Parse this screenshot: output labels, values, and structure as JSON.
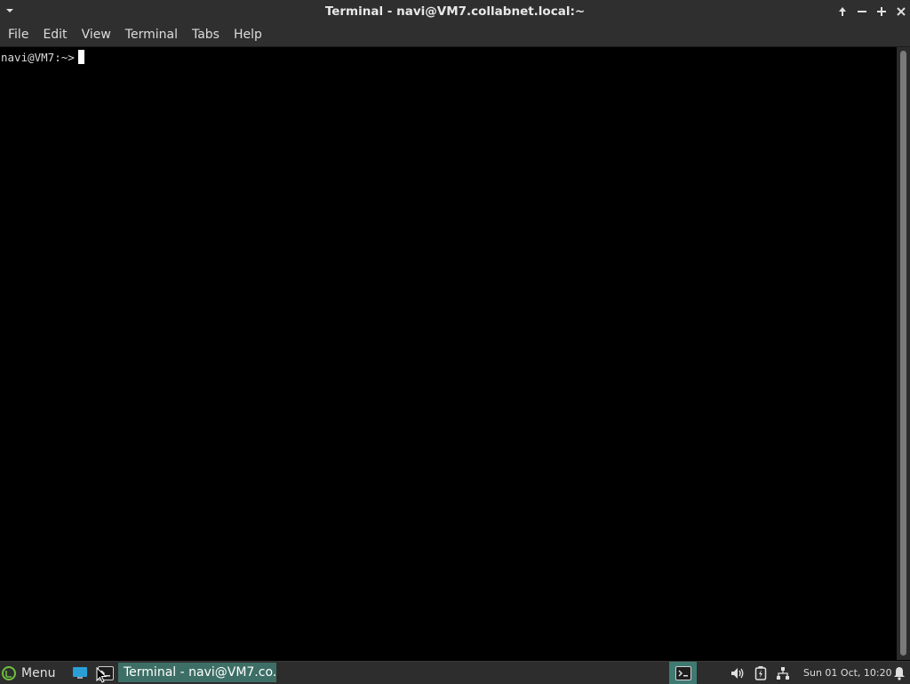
{
  "window": {
    "title": "Terminal - navi@VM7.collabnet.local:~",
    "controls": [
      "maximize-up",
      "minimize",
      "maximize",
      "close"
    ]
  },
  "menubar": {
    "items": [
      "File",
      "Edit",
      "View",
      "Terminal",
      "Tabs",
      "Help"
    ]
  },
  "terminal": {
    "prompt": "navi@VM7:~>"
  },
  "panel": {
    "menu_label": "Menu",
    "task_label": "Terminal - navi@VM7.co...",
    "clock": "Sun 01 Oct, 10:20"
  },
  "colors": {
    "accent": "#3d6f66",
    "titlebar_bg": "#2f2f2f",
    "terminal_bg": "#000000",
    "menu_logo": "#6fbf3f"
  },
  "icons": {
    "window_menu": "chevron-down-icon",
    "panel_menu": "mint-logo-icon",
    "show_desktop": "desktop-icon",
    "terminal": "terminal-icon",
    "volume": "volume-icon",
    "battery": "battery-icon",
    "network": "network-icon",
    "notifications": "bell-icon"
  }
}
